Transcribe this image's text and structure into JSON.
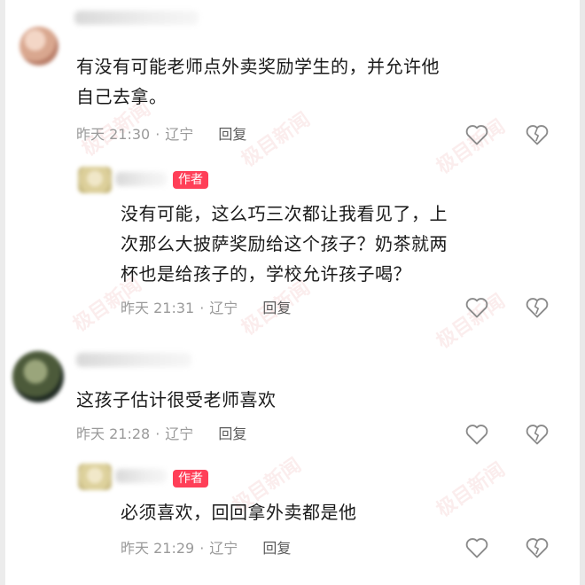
{
  "author_badge": "作者",
  "watermark": "极目新闻",
  "colors": {
    "badge": "#ff3f58",
    "text": "#1a1a1a",
    "meta": "#9a9a9a"
  },
  "comments": [
    {
      "text_lines": [
        "有没有可能老师点外卖奖励学生的，并允许他",
        "自己去拿。"
      ],
      "time": "昨天 21:30",
      "location": "辽宁",
      "reply": "回复",
      "is_author": false
    },
    {
      "text_lines": [
        "没有可能，这么巧三次都让我看见了，上",
        "次那么大披萨奖励给这个孩子？奶茶就两",
        "杯也是给孩子的，学校允许孩子喝？"
      ],
      "time": "昨天 21:31",
      "location": "辽宁",
      "reply": "回复",
      "is_author": true
    },
    {
      "text_lines": [
        "这孩子估计很受老师喜欢"
      ],
      "time": "昨天 21:28",
      "location": "辽宁",
      "reply": "回复",
      "is_author": false
    },
    {
      "text_lines": [
        "必须喜欢，回回拿外卖都是他"
      ],
      "time": "昨天 21:29",
      "location": "辽宁",
      "reply": "回复",
      "is_author": true
    }
  ],
  "icons": {
    "like": "heart-outline-icon",
    "dislike": "broken-heart-icon"
  },
  "separator": "·"
}
